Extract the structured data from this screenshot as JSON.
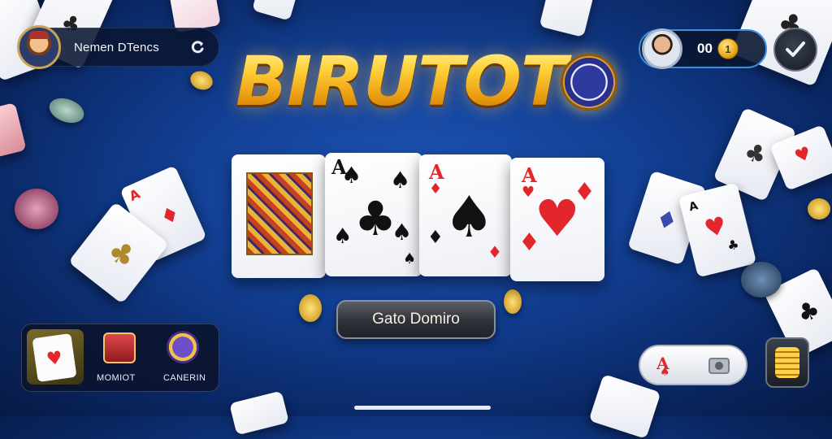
{
  "profile": {
    "player_name": "Nemen DTencs"
  },
  "wallet": {
    "coins": "00",
    "coin_symbol": "1"
  },
  "logo": {
    "title": "BIRUTOTO"
  },
  "hand": [
    {
      "name": "face-card",
      "rank": "",
      "suit": ""
    },
    {
      "name": "ace-of-spades-multi",
      "rank": "A",
      "suit": "♠"
    },
    {
      "name": "ace-of-spades",
      "rank": "A",
      "suit": "♠"
    },
    {
      "name": "ace-of-hearts",
      "rank": "A",
      "suit": "♥"
    }
  ],
  "actions": {
    "play_label": "Gato Domiro"
  },
  "menu": {
    "items": [
      {
        "label": "",
        "icon": "heart-card-icon"
      },
      {
        "label": "MOMIOT",
        "icon": "gift-box-icon"
      },
      {
        "label": "CANERIN",
        "icon": "chip-trophy-icon"
      }
    ]
  },
  "quick": {
    "ace_rank": "A"
  },
  "colors": {
    "accent_blue": "#3b8fe0",
    "gold": "#ffc928",
    "red_suit": "#e3262c",
    "bg_blue": "#123f93"
  }
}
